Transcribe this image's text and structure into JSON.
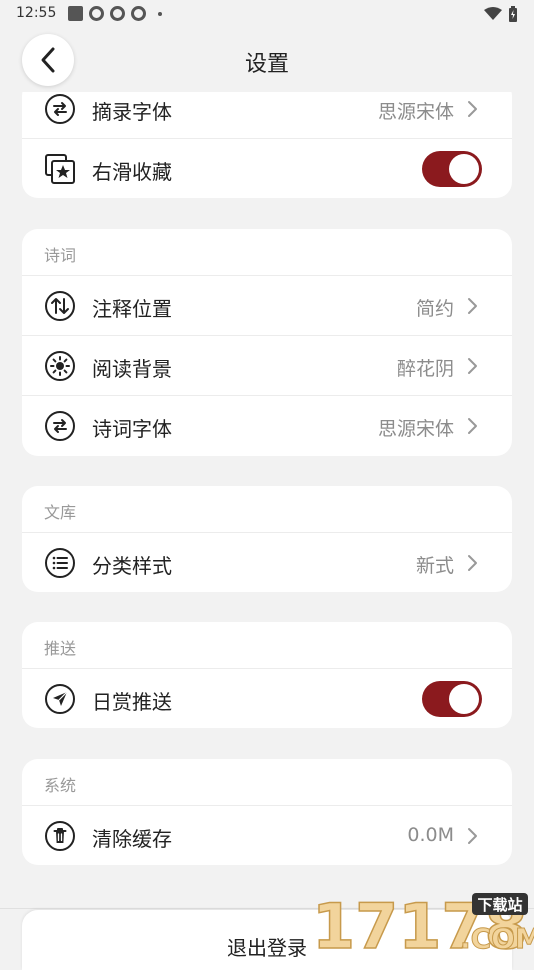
{
  "status_bar": {
    "time": "12:55"
  },
  "header": {
    "title": "设置"
  },
  "card_top": {
    "rows": [
      {
        "label": "摘录字体",
        "value": "思源宋体"
      },
      {
        "label": "右滑收藏",
        "toggle": true
      }
    ]
  },
  "poetry": {
    "section": "诗词",
    "rows": [
      {
        "label": "注释位置",
        "value": "简约"
      },
      {
        "label": "阅读背景",
        "value": "醉花阴"
      },
      {
        "label": "诗词字体",
        "value": "思源宋体"
      }
    ]
  },
  "library": {
    "section": "文库",
    "rows": [
      {
        "label": "分类样式",
        "value": "新式"
      }
    ]
  },
  "push": {
    "section": "推送",
    "rows": [
      {
        "label": "日赏推送",
        "toggle": true
      }
    ]
  },
  "system": {
    "section": "系统",
    "rows": [
      {
        "label": "清除缓存",
        "value": "0.0M"
      }
    ]
  },
  "logout": {
    "label": "退出登录"
  },
  "watermark": {
    "brand": "17178",
    "tag": "下载站",
    "domain": ".COM"
  },
  "colors": {
    "accent": "#8b1a1e",
    "background": "#f2f2f2",
    "card": "#ffffff",
    "secondary_text": "#8c8c8c"
  }
}
